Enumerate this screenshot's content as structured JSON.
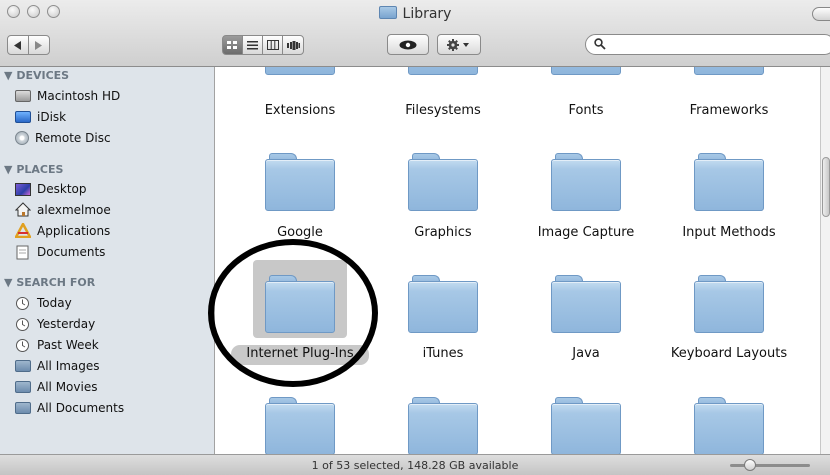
{
  "window": {
    "title": "Library",
    "status_text": "1 of 53 selected, 148.28 GB available",
    "icon_size_slider": 0.2
  },
  "toolbar": {
    "nav_buttons": [
      "back-arrow-icon",
      "forward-arrow-icon"
    ],
    "view_modes": [
      {
        "name": "icon-view",
        "active": true
      },
      {
        "name": "list-view",
        "active": false
      },
      {
        "name": "column-view",
        "active": false
      },
      {
        "name": "coverflow-view",
        "active": false
      }
    ],
    "quick_look_icon": "eye-icon",
    "action_icon": "gear-icon",
    "search": {
      "value": "",
      "placeholder": ""
    }
  },
  "sidebar": {
    "sections": [
      {
        "header": "DEVICES",
        "items": [
          {
            "label": "Macintosh HD",
            "icon": "hard-drive-icon"
          },
          {
            "label": "iDisk",
            "icon": "idisk-icon"
          },
          {
            "label": "Remote Disc",
            "icon": "remote-disc-icon"
          }
        ]
      },
      {
        "header": "PLACES",
        "items": [
          {
            "label": "Desktop",
            "icon": "desktop-icon"
          },
          {
            "label": "alexmelmoe",
            "icon": "home-icon"
          },
          {
            "label": "Applications",
            "icon": "applications-icon"
          },
          {
            "label": "Documents",
            "icon": "documents-icon"
          }
        ]
      },
      {
        "header": "SEARCH FOR",
        "items": [
          {
            "label": "Today",
            "icon": "clock-icon"
          },
          {
            "label": "Yesterday",
            "icon": "clock-icon"
          },
          {
            "label": "Past Week",
            "icon": "clock-icon"
          },
          {
            "label": "All Images",
            "icon": "smart-folder-icon"
          },
          {
            "label": "All Movies",
            "icon": "smart-folder-icon"
          },
          {
            "label": "All Documents",
            "icon": "smart-folder-icon"
          }
        ]
      }
    ]
  },
  "folders": [
    {
      "label": "Extensions",
      "selected": false
    },
    {
      "label": "Filesystems",
      "selected": false
    },
    {
      "label": "Fonts",
      "selected": false
    },
    {
      "label": "Frameworks",
      "selected": false
    },
    {
      "label": "Google",
      "selected": false
    },
    {
      "label": "Graphics",
      "selected": false
    },
    {
      "label": "Image Capture",
      "selected": false
    },
    {
      "label": "Input Methods",
      "selected": false
    },
    {
      "label": "Internet Plug-Ins",
      "selected": true
    },
    {
      "label": "iTunes",
      "selected": false
    },
    {
      "label": "Java",
      "selected": false
    },
    {
      "label": "Keyboard Layouts",
      "selected": false
    },
    {
      "label": "",
      "selected": false
    },
    {
      "label": "",
      "selected": false
    },
    {
      "label": "",
      "selected": false
    },
    {
      "label": "",
      "selected": false
    }
  ],
  "colors": {
    "sidebar_bg": "#dee4ea",
    "sidebar_header": "#6c7884",
    "folder_blue": "#8fb6dc",
    "selection_gray": "#c8c8c8",
    "annotation": "#000000"
  }
}
